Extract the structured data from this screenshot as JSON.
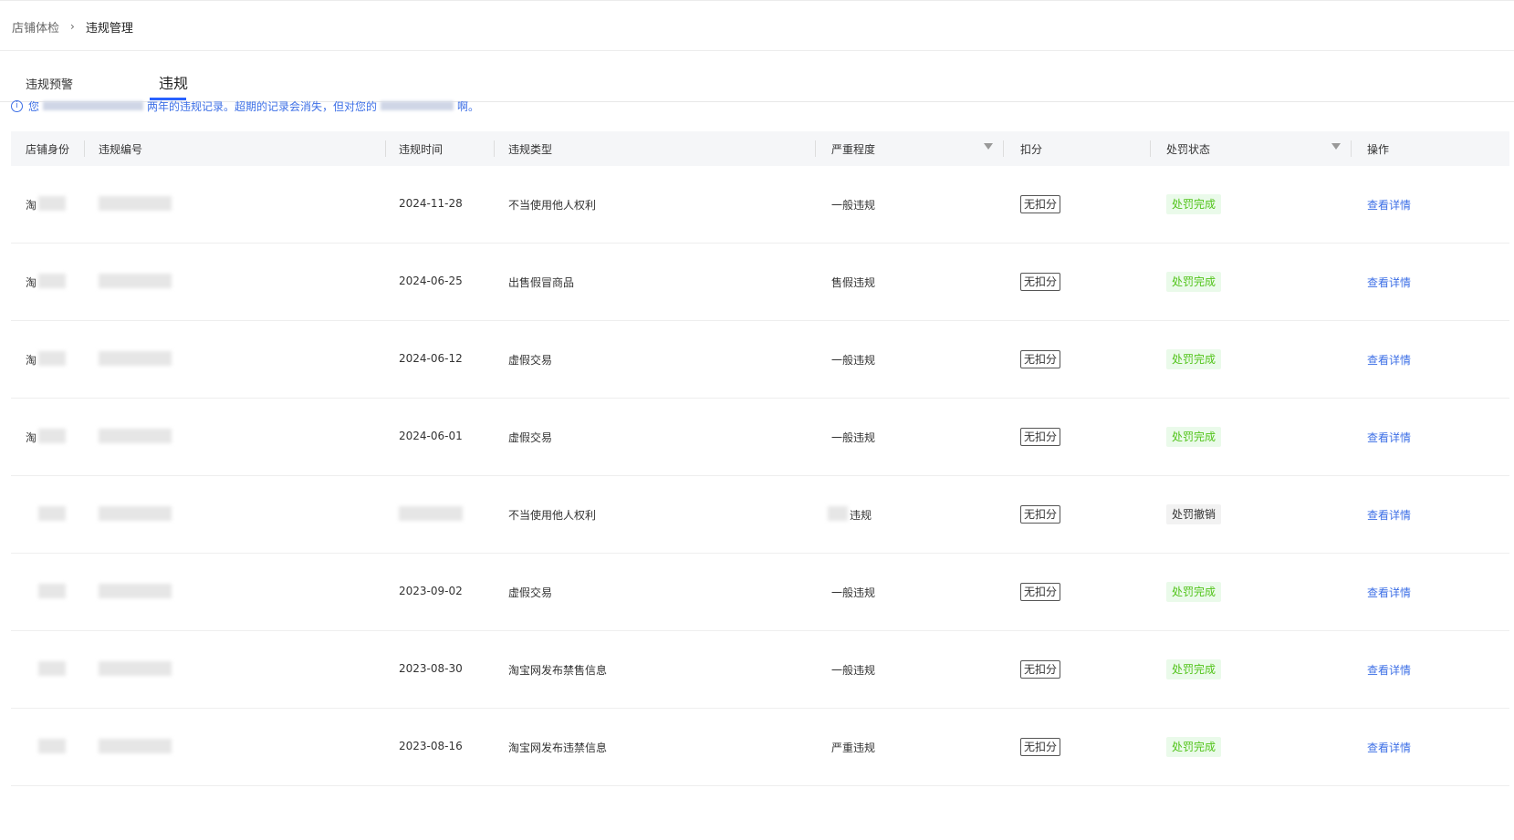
{
  "breadcrumb": {
    "parent": "店铺体检",
    "separator": "›",
    "current": "违规管理"
  },
  "tabs": [
    {
      "label": "违规预警"
    },
    {
      "label": "违规"
    }
  ],
  "notice": {
    "icon": "info-icon",
    "text_before": "您",
    "text_mid": "两年的违规记录。超期的记录会消失，但对您的",
    "text_end": "啊。"
  },
  "table": {
    "headers": {
      "identity": "店铺身份",
      "code": "违规编号",
      "time": "违规时间",
      "type": "违规类型",
      "severity": "严重程度",
      "deduct": "扣分",
      "status": "处罚状态",
      "action": "操作"
    },
    "rows": [
      {
        "identity": "淘",
        "time": "2024-11-28",
        "type": "不当使用他人权利",
        "severity": "一般违规",
        "deduct": "无扣分",
        "status": "处罚完成",
        "status_kind": "done",
        "action": "查看详情"
      },
      {
        "identity": "淘",
        "time": "2024-06-25",
        "type": "出售假冒商品",
        "severity": "售假违规",
        "deduct": "无扣分",
        "status": "处罚完成",
        "status_kind": "done",
        "action": "查看详情"
      },
      {
        "identity": "淘",
        "time": "2024-06-12",
        "type": "虚假交易",
        "severity": "一般违规",
        "deduct": "无扣分",
        "status": "处罚完成",
        "status_kind": "done",
        "action": "查看详情"
      },
      {
        "identity": "淘",
        "time": "2024-06-01",
        "type": "虚假交易",
        "severity": "一般违规",
        "deduct": "无扣分",
        "status": "处罚完成",
        "status_kind": "done",
        "action": "查看详情"
      },
      {
        "identity": "",
        "time": "",
        "type": "不当使用他人权利",
        "severity": "违规",
        "deduct": "无扣分",
        "status": "处罚撤销",
        "status_kind": "revoked",
        "action": "查看详情"
      },
      {
        "identity": "",
        "time": "2023-09-02",
        "type": "虚假交易",
        "severity": "一般违规",
        "deduct": "无扣分",
        "status": "处罚完成",
        "status_kind": "done",
        "action": "查看详情"
      },
      {
        "identity": "",
        "time": "2023-08-30",
        "type": "淘宝网发布禁售信息",
        "severity": "一般违规",
        "deduct": "无扣分",
        "status": "处罚完成",
        "status_kind": "done",
        "action": "查看详情"
      },
      {
        "identity": "",
        "time": "2023-08-16",
        "type": "淘宝网发布违禁信息",
        "severity": "严重违规",
        "deduct": "无扣分",
        "status": "处罚完成",
        "status_kind": "done",
        "action": "查看详情"
      }
    ]
  },
  "colors": {
    "link": "#3d6fe6",
    "status_done_bg": "#eafaea",
    "status_done_text": "#52c41a",
    "header_bg": "#f5f6f8",
    "tab_underline": "#2962ff"
  }
}
